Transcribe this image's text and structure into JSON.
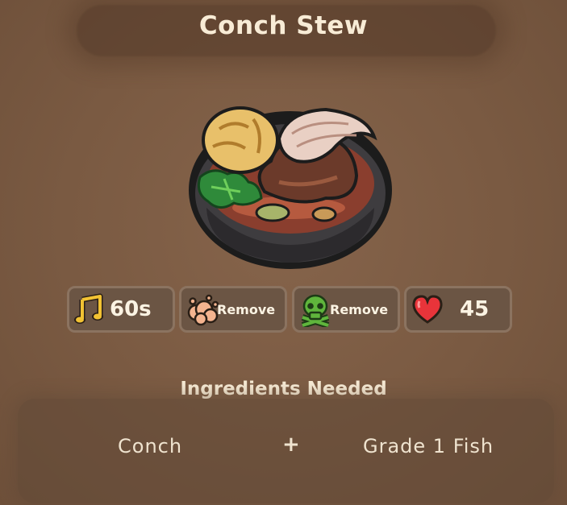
{
  "recipe": {
    "title": "Conch Stew",
    "dish_icon": "conch-stew-bowl-icon"
  },
  "stats": [
    {
      "icon": "music-note-icon",
      "value": "60s",
      "color": "#f2c233"
    },
    {
      "icon": "stink-cloud-icon",
      "value": "Remove",
      "color": "#f4b48f"
    },
    {
      "icon": "skull-crossbones-icon",
      "value": "Remove",
      "color": "#5fb53c"
    },
    {
      "icon": "heart-icon",
      "value": "45",
      "color": "#e8343a"
    }
  ],
  "ingredients": {
    "heading": "Ingredients Needed",
    "items": [
      "Conch",
      "Grade 1 Fish"
    ],
    "separator": "+"
  }
}
